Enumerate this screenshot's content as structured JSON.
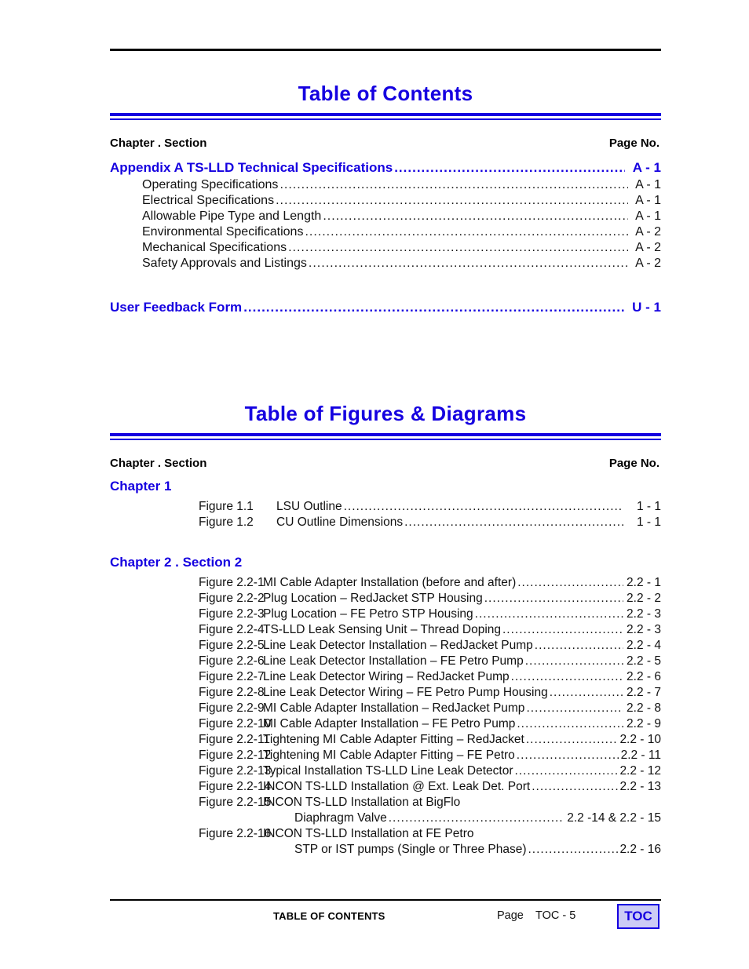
{
  "document": {
    "footer": {
      "center_label": "TABLE OF CONTENTS",
      "page_word": "Page",
      "page_number": "TOC - 5",
      "toc_button": "TOC"
    },
    "colors": {
      "heading_blue": "#1500e0",
      "text_black": "#111111",
      "button_fill": "#ccccf5"
    }
  },
  "section_contents": {
    "title": "Table of Contents",
    "col_head_left": "Chapter . Section",
    "col_head_right": "Page No.",
    "entries": [
      {
        "type": "major",
        "label": "Appendix A    TS-LLD   Technical Specifications",
        "page": "A - 1"
      },
      {
        "type": "sub",
        "label": "Operating  Specifications",
        "page": "A - 1"
      },
      {
        "type": "sub",
        "label": "Electrical Specifications",
        "page": "A - 1"
      },
      {
        "type": "sub",
        "label": "Allowable Pipe Type and Length",
        "page": "A - 1"
      },
      {
        "type": "sub",
        "label": "Environmental  Specifications",
        "page": "A - 2"
      },
      {
        "type": "sub",
        "label": "Mechanical  Specifications",
        "page": "A - 2"
      },
      {
        "type": "sub",
        "label": "Safety Approvals and Listings",
        "page": "A - 2"
      }
    ],
    "trailing_entry": {
      "type": "major",
      "label": "User Feedback Form",
      "page": "U - 1"
    }
  },
  "section_figures": {
    "title": "Table of Figures & Diagrams",
    "col_head_left": "Chapter . Section",
    "col_head_right": "Page No.",
    "groups": [
      {
        "heading": "Chapter 1",
        "figures": [
          {
            "num": "Figure 1.1",
            "desc": "LSU Outline",
            "page": "1 - 1"
          },
          {
            "num": "Figure 1.2",
            "desc": "CU Outline Dimensions",
            "page": "1 - 1"
          }
        ]
      },
      {
        "heading": "Chapter 2 . Section 2",
        "figures": [
          {
            "num": "Figure 2.2-1",
            "desc": "MI Cable Adapter Installation (before and after)",
            "page": "2.2 - 1"
          },
          {
            "num": "Figure 2.2-2",
            "desc": "Plug Location – RedJacket STP Housing",
            "page": "2.2 - 2"
          },
          {
            "num": "Figure 2.2-3",
            "desc": "Plug Location – FE Petro STP Housing",
            "page": "2.2 - 3"
          },
          {
            "num": "Figure 2.2-4",
            "desc": "TS-LLD Leak Sensing Unit – Thread Doping",
            "page": "2.2 - 3"
          },
          {
            "num": "Figure 2.2-5",
            "desc": "Line Leak Detector Installation – RedJacket Pump",
            "page": "2.2 - 4"
          },
          {
            "num": "Figure 2.2-6",
            "desc": "Line Leak Detector Installation – FE Petro Pump",
            "page": "2.2 - 5"
          },
          {
            "num": "Figure 2.2-7",
            "desc": "Line Leak Detector Wiring – RedJacket Pump",
            "page": "2.2 - 6"
          },
          {
            "num": "Figure 2.2-8",
            "desc": "Line Leak Detector Wiring – FE Petro Pump Housing",
            "page": "2.2 - 7"
          },
          {
            "num": "Figure 2.2-9",
            "desc": "MI Cable Adapter Installation – RedJacket Pump",
            "page": "2.2 - 8"
          },
          {
            "num": "Figure 2.2-10",
            "desc": "MI Cable Adapter Installation – FE Petro Pump",
            "page": "2.2 - 9"
          },
          {
            "num": "Figure 2.2-11",
            "desc": "Tightening MI Cable Adapter Fitting – RedJacket",
            "page": "2.2 - 10"
          },
          {
            "num": "Figure 2.2-12",
            "desc": "Tightening MI Cable Adapter Fitting – FE Petro",
            "page": "2.2 - 11"
          },
          {
            "num": "Figure 2.2-13",
            "desc": "Typical Installation TS-LLD Line Leak Detector",
            "page": "2.2 - 12"
          },
          {
            "num": "Figure 2.2-14",
            "desc": "INCON TS-LLD Installation @ Ext. Leak Det. Port",
            "page": "2.2 - 13"
          },
          {
            "num": "Figure 2.2-15",
            "desc": "INCON TS-LLD Installation at BigFlo",
            "page": "",
            "cont_desc": "Diaphragm Valve",
            "cont_page": "2.2 -14  &  2.2 - 15"
          },
          {
            "num": "Figure 2.2-16",
            "desc": "INCON TS-LLD Installation at FE Petro",
            "page": "",
            "cont_desc": "STP or IST pumps (Single or Three Phase)",
            "cont_page": "2.2 - 16"
          }
        ]
      }
    ]
  }
}
